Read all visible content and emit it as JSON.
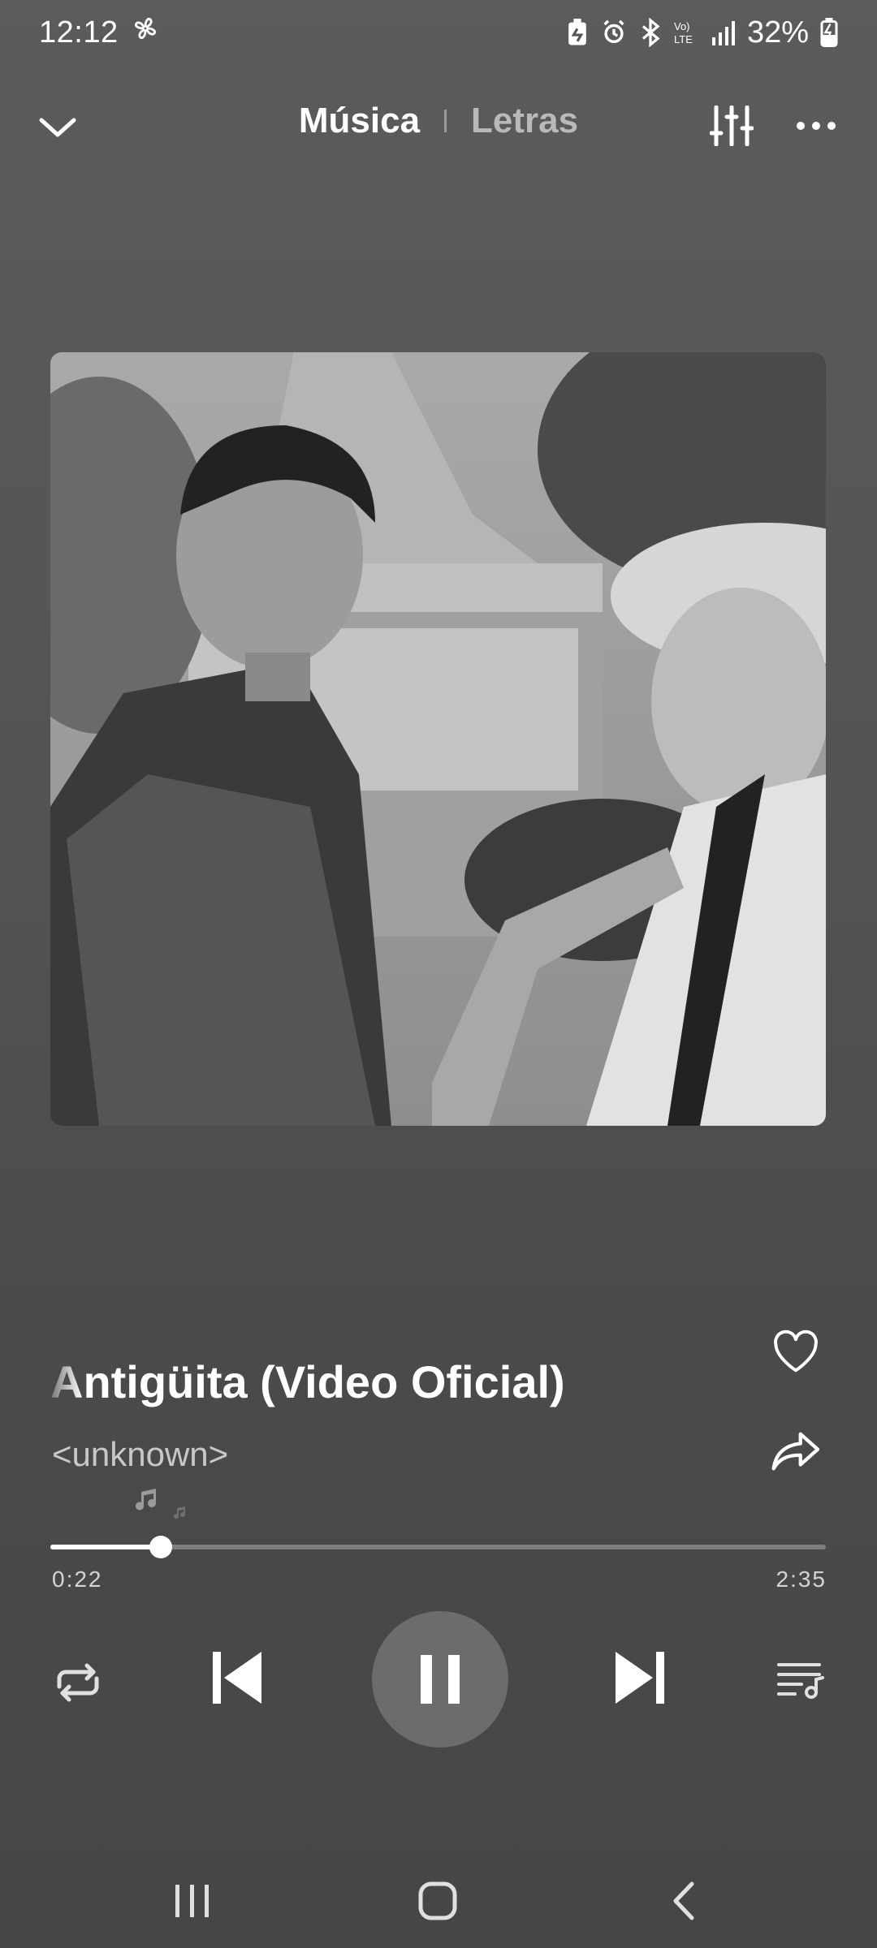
{
  "status_bar": {
    "time": "12:12",
    "battery_percent": "32%",
    "icons": [
      "fan-icon",
      "battery-saver-icon",
      "alarm-icon",
      "bluetooth-icon",
      "volte-icon",
      "signal-icon",
      "battery-charging-icon"
    ]
  },
  "header": {
    "tab_music": "Música",
    "tab_lyrics": "Letras"
  },
  "track": {
    "title": "Antigüita (Video Oficial)",
    "artist": "<unknown>",
    "elapsed": "0:22",
    "duration": "2:35",
    "progress_fraction": 0.142
  },
  "colors": {
    "background": "#555555",
    "play_button_bg": "#6c6c6c",
    "progress_track": "#7e7e7e",
    "progress_fill": "#ffffff"
  }
}
